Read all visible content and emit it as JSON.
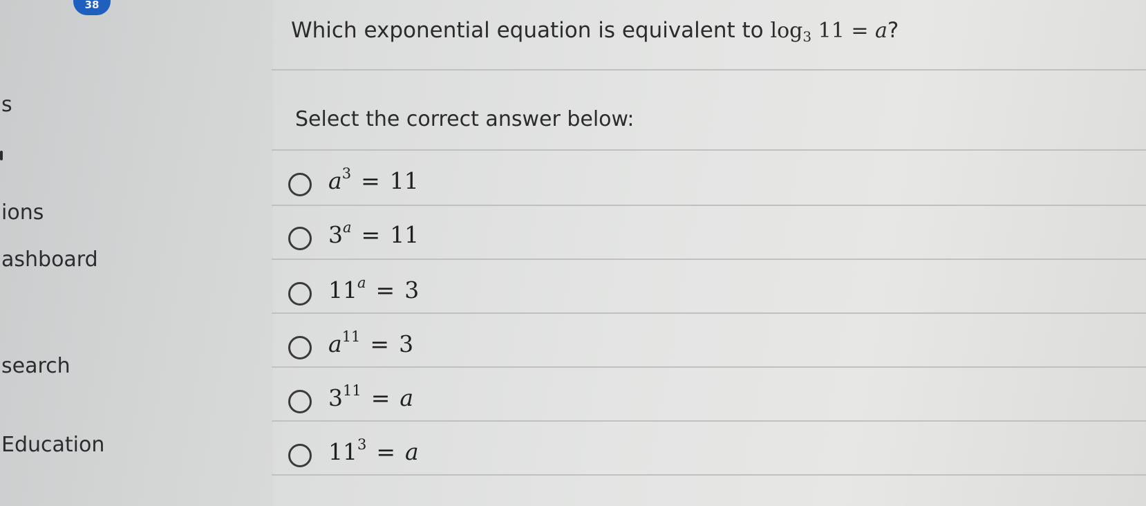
{
  "sidebar": {
    "badge": "38",
    "items": [
      {
        "label": "s"
      },
      {
        "label": "ions"
      },
      {
        "label": "ashboard"
      },
      {
        "label": "search"
      },
      {
        "label": "Education"
      }
    ]
  },
  "question": {
    "prefix": "Which exponential equation is equivalent to ",
    "log_word": "log",
    "log_base": "3",
    "log_arg": " 11 = ",
    "log_var": "a",
    "suffix": "?"
  },
  "prompt": "Select the correct answer below:",
  "options": [
    {
      "base": "a",
      "base_var": true,
      "exp": "3",
      "exp_var": false,
      "rhs": "11",
      "rhs_var": false
    },
    {
      "base": "3",
      "base_var": false,
      "exp": "a",
      "exp_var": true,
      "rhs": "11",
      "rhs_var": false
    },
    {
      "base": "11",
      "base_var": false,
      "exp": "a",
      "exp_var": true,
      "rhs": "3",
      "rhs_var": false
    },
    {
      "base": "a",
      "base_var": true,
      "exp": "11",
      "exp_var": false,
      "rhs": "3",
      "rhs_var": false
    },
    {
      "base": "3",
      "base_var": false,
      "exp": "11",
      "exp_var": false,
      "rhs": "a",
      "rhs_var": true
    },
    {
      "base": "11",
      "base_var": false,
      "exp": "3",
      "exp_var": false,
      "rhs": "a",
      "rhs_var": true
    }
  ],
  "equals_sign": "=",
  "colors": {
    "badge": "#1f5fbd",
    "divider": "#bfc0bf",
    "radio_border": "#3a3a3a"
  }
}
